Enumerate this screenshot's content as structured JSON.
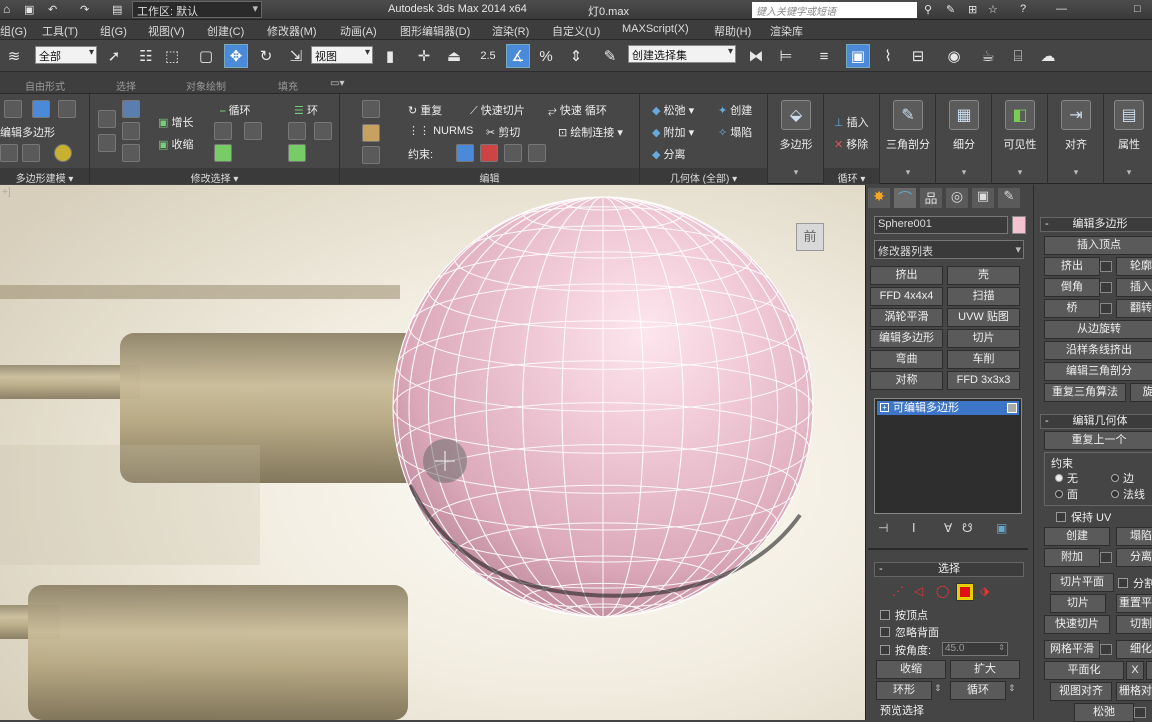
{
  "title_bar": {
    "workspace_label": "工作区: 默认",
    "app_title": "Autodesk 3ds Max  2014 x64",
    "file_name": "灯0.max",
    "search_placeholder": "键入关键字或短语"
  },
  "menu": [
    "组(G)",
    "工具(T)",
    "组(G)",
    "视图(V)",
    "创建(C)",
    "修改器(M)",
    "动画(A)",
    "图形编辑器(D)",
    "渲染(R)",
    "自定义(U)",
    "MAXScript(X)",
    "帮助(H)",
    "渲染库"
  ],
  "main_toolbar": {
    "filter_dropdown": "全部",
    "refcoord_dropdown": "视图",
    "snap_angle_label": "2.5",
    "named_selection": "创建选择集"
  },
  "ribbon_tabs": [
    "自由形式",
    "选择",
    "对象绘制",
    "填充"
  ],
  "ribbon": {
    "modeling_group": {
      "label": "多边形建模",
      "title": "编辑多边形"
    },
    "modify_selection": {
      "label": "修改选择",
      "grow": "增长",
      "shrink": "收缩",
      "loop": "循环",
      "ring": "环"
    },
    "edit": {
      "label": "编辑",
      "repeat": "重复",
      "quickslice": "快速切片",
      "quickloop": "快速 循环",
      "nurms": "NURMS",
      "cut": "剪切",
      "paint_connect": "绘制连接",
      "constrain_label": "约束:"
    },
    "geometry": {
      "label": "几何体 (全部)",
      "relax": "松弛",
      "create": "创建",
      "attach": "附加",
      "collapse": "塌陷",
      "detach": "分离"
    },
    "loops": {
      "label": "循环",
      "insert": "插入",
      "remove": "移除"
    },
    "big_buttons": [
      {
        "label": "多边形"
      },
      {
        "label": "三角剖分"
      },
      {
        "label": "细分"
      },
      {
        "label": "可见性"
      },
      {
        "label": "对齐"
      },
      {
        "label": "属性"
      }
    ]
  },
  "viewport": {
    "viewcube_face": "前",
    "corner_label": "+]",
    "sphere_color": "#f2d2dc",
    "wire_color": "#ffffff"
  },
  "command_panel": {
    "object_name": "Sphere001",
    "object_color": "#f5c3d0",
    "modifier_list": "修改器列表",
    "modifier_buttons": [
      [
        "挤出",
        "壳"
      ],
      [
        "FFD 4x4x4",
        "扫描"
      ],
      [
        "涡轮平滑",
        "UVW 贴图"
      ],
      [
        "编辑多边形",
        "切片"
      ],
      [
        "弯曲",
        "车削"
      ],
      [
        "对称",
        "FFD 3x3x3"
      ]
    ],
    "stack_item": "可编辑多边形",
    "selection_rollout": {
      "title": "选择",
      "by_vertex": "按顶点",
      "ignore_backfacing": "忽略背面",
      "by_angle": "按角度:",
      "angle_value": "45.0",
      "shrink": "收缩",
      "grow": "扩大",
      "ring": "环形",
      "loop": "循环",
      "preview": "预览选择"
    }
  },
  "right_panel": {
    "edit_poly_title": "编辑多边形",
    "insert_vertex": "插入顶点",
    "extrude": "挤出",
    "outline": "轮廓",
    "bevel": "倒角",
    "inset": "插入",
    "bridge": "桥",
    "flip": "翻转",
    "from_edge": "从边旋转",
    "along_spline": "沿样条线挤出",
    "edit_tri": "编辑三角剖分",
    "retriangulate": "重复三角算法",
    "turn": "旋",
    "edit_geo_title": "编辑几何体",
    "repeat_last": "重复上一个",
    "constraints_label": "约束",
    "none": "无",
    "edge": "边",
    "face": "面",
    "normal": "法线",
    "preserve_uv": "保持 UV",
    "create": "创建",
    "collapse": "塌陷",
    "attach": "附加",
    "detach": "分离",
    "slice_plane": "切片平面",
    "split": "分割",
    "slice": "切片",
    "reset_plane": "重置平面",
    "quickslice": "快速切片",
    "cut": "切割",
    "meshsmooth": "网格平滑",
    "tessellate": "细化",
    "planarize": "平面化",
    "x": "X",
    "view_align": "视图对齐",
    "grid_align": "栅格对齐",
    "relax": "松弛"
  }
}
